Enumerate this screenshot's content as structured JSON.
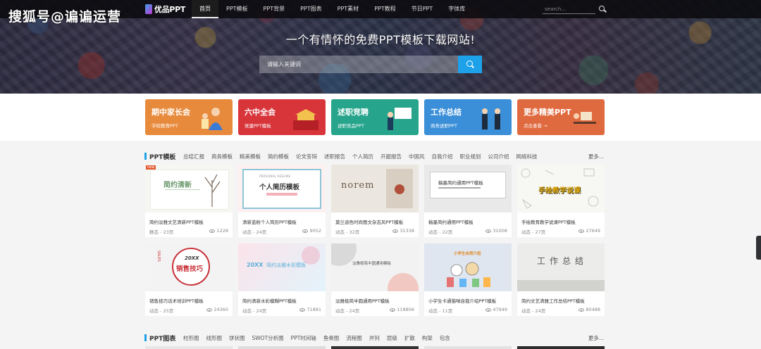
{
  "watermark": "搜狐号@谝谝运营",
  "logo": {
    "text": "优品PPT"
  },
  "nav": [
    {
      "label": "首页",
      "active": true
    },
    {
      "label": "PPT模板"
    },
    {
      "label": "PPT背景"
    },
    {
      "label": "PPT图表"
    },
    {
      "label": "PPT素材"
    },
    {
      "label": "PPT教程"
    },
    {
      "label": "节日PPT"
    },
    {
      "label": "字体库"
    }
  ],
  "top_search": {
    "placeholder": "search..."
  },
  "hero": {
    "tagline": "一个有情怀的免费PPT模板下载网站!",
    "search_placeholder": "请输入关键词"
  },
  "categories": [
    {
      "title": "期中家长会",
      "sub": "学校教育PPT",
      "color": "#e88a3c"
    },
    {
      "title": "六中全会",
      "sub": "党建PPT模板",
      "color": "#d8353b"
    },
    {
      "title": "述职竞聘",
      "sub": "述职竞品PPT",
      "color": "#27a58c"
    },
    {
      "title": "工作总结",
      "sub": "商务述职PPT",
      "color": "#3a8fd8"
    },
    {
      "title": "更多精美PPT",
      "sub": "点击查看 →",
      "color": "#e06a3f"
    }
  ],
  "section_templates": {
    "title": "PPT模板",
    "tags": [
      "总结汇报",
      "商务模板",
      "精美模板",
      "简约模板",
      "论文答辩",
      "述职报告",
      "个人简历",
      "开题报告",
      "中国风",
      "自我介绍",
      "职业规划",
      "公司介绍",
      "网络科技"
    ],
    "more": "更多..."
  },
  "cards": [
    {
      "title": "简约淡雅文艺清新PPT模板",
      "meta": "静态 - 23页",
      "views": "1228",
      "badge": "new",
      "thumb_text": "简约清新"
    },
    {
      "title": "清新蓝粉个人简历PPT模板",
      "meta": "动态 - 24页",
      "views": "9052",
      "thumb_text": "个人简历模板",
      "thumb_sub": "PERSONAL RESUME"
    },
    {
      "title": "莫兰迪色时尚图文杂志风PPT模板",
      "meta": "动态 - 32页",
      "views": "31338",
      "thumb_text": "norem"
    },
    {
      "title": "稿墨简约通用PPT模板",
      "meta": "动态 - 22页",
      "views": "31008",
      "thumb_text": "稿墨简约通用PPT模板"
    },
    {
      "title": "手绘教育教学说课PPT模板",
      "meta": "动态 - 27页",
      "views": "27649",
      "thumb_text": "手绘教学说课"
    },
    {
      "title": "销售技巧话术培训PPT模板",
      "meta": "动态 - 25页",
      "views": "24360",
      "thumb_text": "销售技巧",
      "thumb_sub": "20XX",
      "thumb_side": "SALES"
    },
    {
      "title": "简约清新水彩模糊PPT模板",
      "meta": "动态 - 24页",
      "views": "71881",
      "thumb_text": "简约淡雅水彩模板",
      "thumb_sub": "20XX"
    },
    {
      "title": "淡雅极简半圆通用PPT模板",
      "meta": "动态 - 24页",
      "views": "118806",
      "thumb_text": "淡雅极简半圆通用模板"
    },
    {
      "title": "小学生卡通猫咪自我介绍PPT模板",
      "meta": "动态 - 11页",
      "views": "47949",
      "thumb_text": "小学生自我介绍"
    },
    {
      "title": "简约文艺清雅工作总结PPT模板",
      "meta": "动态 - 24页",
      "views": "80488",
      "thumb_text": "工作总结"
    }
  ],
  "section_charts": {
    "title": "PPT图表",
    "tags": [
      "柱形图",
      "线形图",
      "饼状图",
      "SWOT分析图",
      "PPT时间轴",
      "鱼骨图",
      "流程图",
      "并列",
      "层级",
      "扩散",
      "构架",
      "包含"
    ],
    "more": "更多..."
  }
}
